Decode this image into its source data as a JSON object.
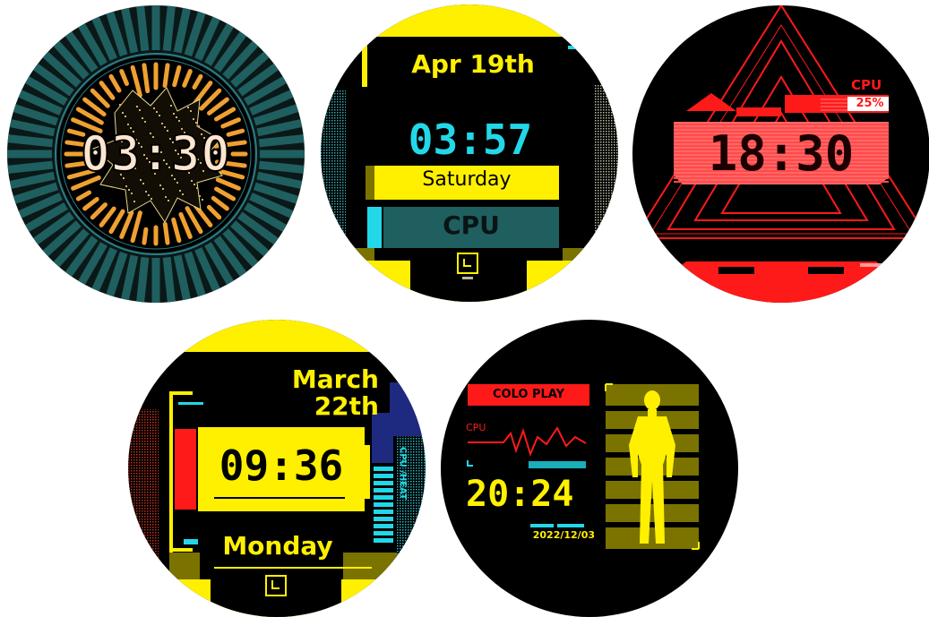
{
  "faces": [
    {
      "time": "03:30"
    },
    {
      "date": "Apr 19th",
      "time": "03:57",
      "day": "Saturday",
      "cpu_label": "CPU",
      "clock_icon": "clock-icon"
    },
    {
      "cpu_label": "CPU",
      "cpu_value": "25%",
      "time": "18:30"
    },
    {
      "date_line1": "March",
      "date_line2": "22th",
      "cpu_heat_label": "CPU /HEAT",
      "time": "09:36",
      "day": "Monday",
      "clock_icon": "clock-icon"
    },
    {
      "brand": "COLO PLAY",
      "cpu_label": "CPU",
      "time": "20:24",
      "date": "2022/12/03",
      "body_icon": "human-body-icon"
    }
  ],
  "colors": {
    "teal": "#1f5f5f",
    "orange": "#f0a030",
    "yellow": "#fff000",
    "cyan": "#22d8e8",
    "red": "#ff1a1a",
    "olive": "#7a7300"
  }
}
